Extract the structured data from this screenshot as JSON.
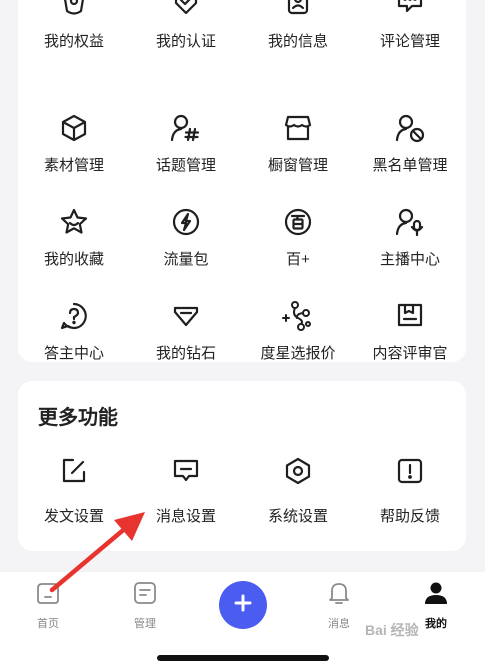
{
  "grid_items": [
    {
      "label": "我的权益",
      "icon": "gift-box-icon"
    },
    {
      "label": "我的认证",
      "icon": "badge-check-icon"
    },
    {
      "label": "我的信息",
      "icon": "id-card-icon"
    },
    {
      "label": "评论管理",
      "icon": "comment-icon"
    },
    {
      "label": "素材管理",
      "icon": "cube-icon"
    },
    {
      "label": "话题管理",
      "icon": "user-hashtag-icon"
    },
    {
      "label": "橱窗管理",
      "icon": "shop-window-icon"
    },
    {
      "label": "黑名单管理",
      "icon": "user-block-icon"
    },
    {
      "label": "我的收藏",
      "icon": "star-icon"
    },
    {
      "label": "流量包",
      "icon": "lightning-icon"
    },
    {
      "label": "百+",
      "icon": "bai-plus-icon"
    },
    {
      "label": "主播中心",
      "icon": "user-mic-icon"
    },
    {
      "label": "答主中心",
      "icon": "question-icon"
    },
    {
      "label": "我的钻石",
      "icon": "diamond-icon"
    },
    {
      "label": "度星选报价",
      "icon": "star-link-icon"
    },
    {
      "label": "内容评审官",
      "icon": "review-icon"
    }
  ],
  "more_section": {
    "title": "更多功能",
    "items": [
      {
        "label": "发文设置",
        "icon": "edit-square-icon"
      },
      {
        "label": "消息设置",
        "icon": "message-icon"
      },
      {
        "label": "系统设置",
        "icon": "hexagon-gear-icon"
      },
      {
        "label": "帮助反馈",
        "icon": "exclamation-square-icon"
      }
    ]
  },
  "tabbar": {
    "home": "首页",
    "manage": "管理",
    "messages": "消息",
    "me": "我的"
  },
  "colors": {
    "accent": "#4b5cf0",
    "arrow": "#e8342f"
  },
  "watermark": "Bai 经验"
}
